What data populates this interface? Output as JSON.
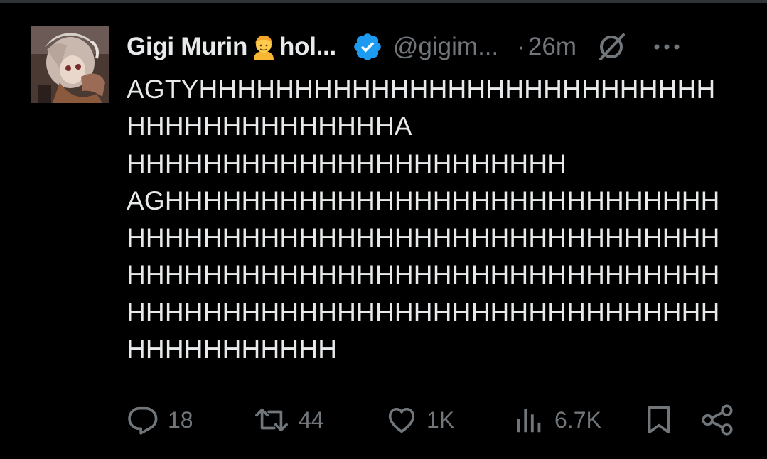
{
  "post": {
    "author": {
      "display_name": "Gigi Murin",
      "name_suffix": "hol...",
      "emoji": "person-emoji",
      "verified": true,
      "verified_color": "#1d9bf0",
      "handle": "@gigim...",
      "avatar": "anime-character-avatar"
    },
    "meta": {
      "separator": "·",
      "timestamp": "26m"
    },
    "text_lines": [
      "AGTYHHHHHHHHHHHHHHHHHHHHHHHHHHH",
      "HHHHHHHHHHHHHHA",
      "HHHHHHHHHHHHHHHHHHHHHHH",
      "AGHHHHHHHHHHHHHHHHHHHHHHHHHHHHH",
      "HHHHHHHHHHHHHHHHHHHHHHHHHHHHHHH",
      "HHHHHHHHHHHHHHHHHHHHHHHHHHHHHHH",
      "HHHHHHHHHHHHHHHHHHHHHHHHHHHHHHH",
      "HHHHHHHHHHH"
    ],
    "actions": {
      "replies": "18",
      "reposts": "44",
      "likes": "1K",
      "views": "6.7K"
    }
  },
  "icons": {
    "grok": "grok-icon",
    "more": "more-icon",
    "reply": "reply-icon",
    "repost": "repost-icon",
    "like": "like-icon",
    "views": "views-icon",
    "bookmark": "bookmark-icon",
    "share": "share-icon"
  },
  "colors": {
    "background": "#000000",
    "text": "#e7e9ea",
    "muted": "#71767b",
    "accent": "#1d9bf0"
  }
}
